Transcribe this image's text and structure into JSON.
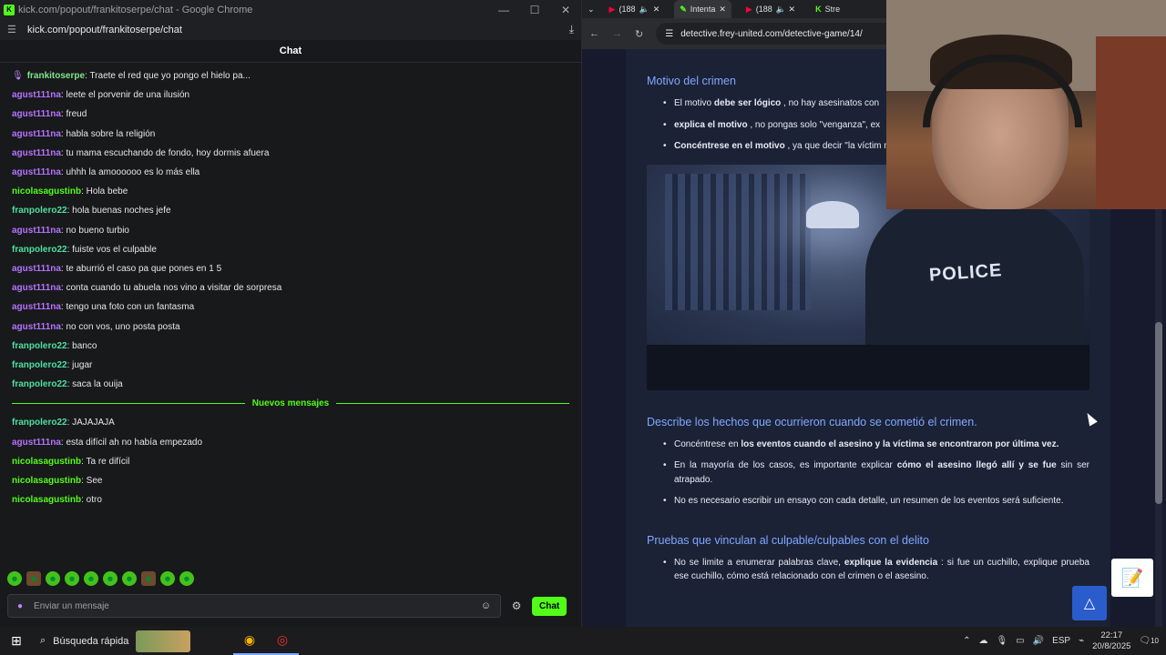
{
  "left_window": {
    "title": "kick.com/popout/frankitoserpe/chat - Google Chrome",
    "url": "kick.com/popout/frankitoserpe/chat",
    "chat_header": "Chat",
    "messages": [
      {
        "user": "frankitoserpe",
        "text": ": Traete el red que yo pongo el hielo pa...",
        "color": "#7ee787",
        "pinned": true
      },
      {
        "user": "agust111na",
        "text": ": leete el porvenir de una ilusión",
        "color": "#b573ff"
      },
      {
        "user": "agust111na",
        "text": ": freud",
        "color": "#b573ff"
      },
      {
        "user": "agust111na",
        "text": ": habla sobre la religión",
        "color": "#b573ff"
      },
      {
        "user": "agust111na",
        "text": ": tu mama escuchando de fondo, hoy dormis afuera",
        "color": "#b573ff"
      },
      {
        "user": "agust111na",
        "text": ": uhhh la amoooooo es lo más ella",
        "color": "#b573ff"
      },
      {
        "user": "nicolasagustinb",
        "text": ": Hola bebe",
        "color": "#53fc18"
      },
      {
        "user": "franpolero22",
        "text": ": hola buenas noches jefe",
        "color": "#4ee0a0"
      },
      {
        "user": "agust111na",
        "text": ": no bueno turbio",
        "color": "#b573ff"
      },
      {
        "user": "franpolero22",
        "text": ": fuiste vos el culpable",
        "color": "#4ee0a0"
      },
      {
        "user": "agust111na",
        "text": ": te aburrió el caso pa que pones en 1 5",
        "color": "#b573ff"
      },
      {
        "user": "agust111na",
        "text": ": conta cuando tu abuela nos vino a visitar de sorpresa",
        "color": "#b573ff"
      },
      {
        "user": "agust111na",
        "text": ": tengo una foto con un fantasma",
        "color": "#b573ff"
      },
      {
        "user": "agust111na",
        "text": ": no con vos, uno posta posta",
        "color": "#b573ff"
      },
      {
        "user": "franpolero22",
        "text": ": banco",
        "color": "#4ee0a0"
      },
      {
        "user": "franpolero22",
        "text": ": jugar",
        "color": "#4ee0a0"
      },
      {
        "user": "franpolero22",
        "text": ": saca la ouija",
        "color": "#4ee0a0"
      }
    ],
    "new_messages_label": "Nuevos mensajes",
    "new_messages": [
      {
        "user": "franpolero22",
        "text": ": JAJAJAJA",
        "color": "#4ee0a0"
      },
      {
        "user": "agust111na",
        "text": ": esta difícil ah no había empezado",
        "color": "#b573ff"
      },
      {
        "user": "nicolasagustinb",
        "text": ": Ta re difícil",
        "color": "#53fc18"
      },
      {
        "user": "nicolasagustinb",
        "text": ": See",
        "color": "#53fc18"
      },
      {
        "user": "nicolasagustinb",
        "text": ": otro",
        "color": "#53fc18"
      }
    ],
    "input_placeholder": "Enviar un mensaje",
    "chat_button": "Chat",
    "accent": "#53fc18"
  },
  "right_window": {
    "tabs": [
      {
        "label": "(188",
        "icon": "youtube-icon"
      },
      {
        "label": "Intenta",
        "icon": "kick-icon",
        "active": true
      },
      {
        "label": "(188",
        "icon": "youtube-icon"
      },
      {
        "label": "Stre",
        "icon": "kick-icon"
      }
    ],
    "url": "detective.frey-united.com/detective-game/14/",
    "sections": {
      "motive": {
        "heading": "Motivo del crimen",
        "bullets": [
          {
            "pre": "El motivo ",
            "bold": "debe ser lógico",
            "post": " , no hay asesinatos con"
          },
          {
            "pre": "",
            "bold": "explica el motivo",
            "post": " , no pongas solo \"venganza\", ex"
          },
          {
            "pre": "",
            "bold": "Concéntrese en el motivo",
            "post": " , ya que decir \"la víctim nada que ver con el motivo."
          }
        ]
      },
      "image_text": "POLICE",
      "facts": {
        "heading": "Describe los hechos que ocurrieron cuando se cometió el crimen.",
        "bullets": [
          {
            "pre": "Concéntrese en ",
            "bold": "los eventos cuando el asesino y la víctima se encontraron por última vez.",
            "post": ""
          },
          {
            "pre": "En la mayoría de los casos, es importante explicar ",
            "bold": "cómo el asesino llegó allí y se fue",
            "post": " sin ser atrapado."
          },
          {
            "pre": "No es necesario escribir un ensayo con cada detalle, un resumen de los eventos será suficiente.",
            "bold": "",
            "post": ""
          }
        ]
      },
      "evidence": {
        "heading": "Pruebas que vinculan al culpable/culpables con el delito",
        "bullets": [
          {
            "pre": "No se limite a enumerar palabras clave, ",
            "bold": "explique la evidencia",
            "post": " : si fue un cuchillo, explique prueba ese cuchillo, cómo está relacionado con el crimen o el asesino."
          }
        ]
      }
    }
  },
  "taskbar": {
    "search_label": "Búsqueda rápida",
    "language": "ESP",
    "time": "22:17",
    "date": "20/8/2025",
    "notifications": "10"
  }
}
